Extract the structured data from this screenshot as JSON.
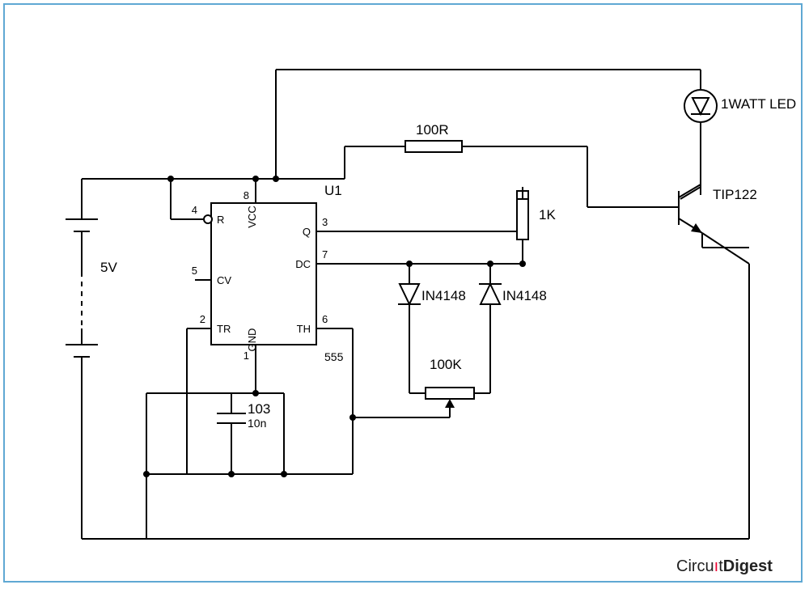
{
  "schematic": {
    "source": {
      "voltage": "5V"
    },
    "ic": {
      "ref": "U1",
      "part": "555",
      "pins": {
        "1": "GND",
        "2": "TR",
        "3": "Q",
        "4": "R",
        "5": "CV",
        "6": "TH",
        "7": "DC",
        "8": "VCC"
      }
    },
    "resistors": {
      "r_series": "100R",
      "r_pin3": "1K",
      "pot": "100K"
    },
    "capacitor": {
      "code": "103",
      "value": "10n"
    },
    "diodes": {
      "d1": "IN4148",
      "d2": "IN4148"
    },
    "transistor": "TIP122",
    "led": "1WATT LED",
    "brand": {
      "a": "Circu",
      "i": "ı",
      "b": "t",
      "c": "Digest"
    }
  }
}
